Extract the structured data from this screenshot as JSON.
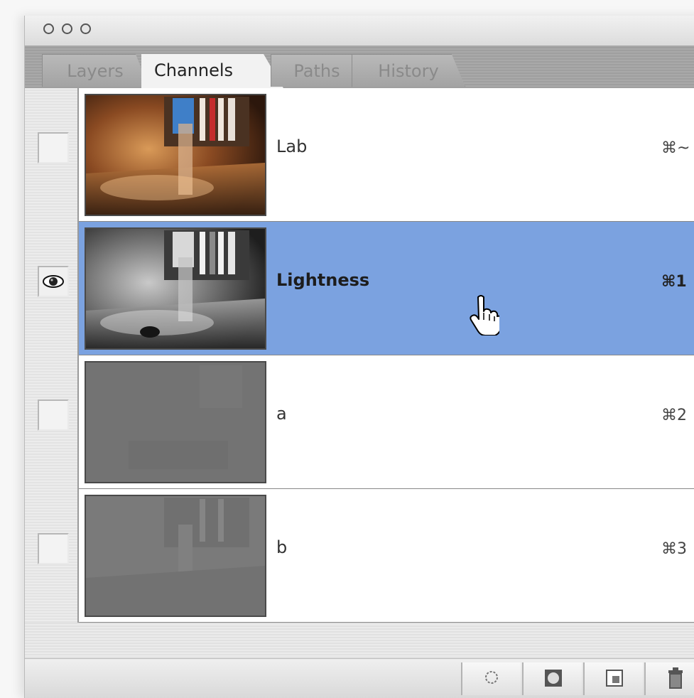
{
  "window": {
    "buttons": [
      "close",
      "minimize",
      "zoom"
    ]
  },
  "tabs": [
    {
      "label": "Layers",
      "active": false
    },
    {
      "label": "Channels",
      "active": true
    },
    {
      "label": "Paths",
      "active": false
    },
    {
      "label": "History",
      "active": false
    }
  ],
  "channels": [
    {
      "name": "Lab",
      "shortcut": "⌘~",
      "visible": false,
      "selected": false,
      "thumb": "color-room-scene"
    },
    {
      "name": "Lightness",
      "shortcut": "⌘1",
      "visible": true,
      "selected": true,
      "thumb": "grayscale-room-scene"
    },
    {
      "name": "a",
      "shortcut": "⌘2",
      "visible": false,
      "selected": false,
      "thumb": "flat-gray"
    },
    {
      "name": "b",
      "shortcut": "⌘3",
      "visible": false,
      "selected": false,
      "thumb": "faint-gray-scene"
    }
  ],
  "cursor": "pointing-hand-cursor",
  "footer_buttons": [
    "load-channel-as-selection-icon",
    "save-selection-as-channel-icon",
    "new-channel-icon",
    "delete-channel-icon"
  ],
  "colors": {
    "selected_row": "#7ba2e0",
    "panel_bg": "#e9e9e9"
  }
}
